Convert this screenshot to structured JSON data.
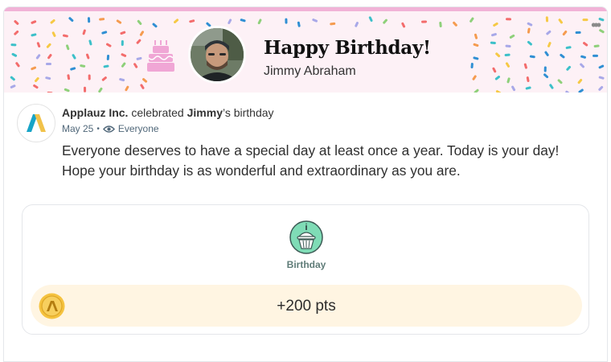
{
  "banner": {
    "title": "Happy Birthday!",
    "name": "Jimmy Abraham",
    "more_icon": "ellipsis-icon",
    "colors": {
      "background": "#fdf1f6",
      "stripe": "#f1b2d7",
      "cake": "#f0a6d5"
    }
  },
  "post": {
    "company": "Applauz Inc.",
    "action_pre": " celebrated ",
    "person": "Jimmy",
    "action_post": "’s birthday",
    "date": "May 25",
    "separator": "•",
    "visibility": "Everyone",
    "message": "Everyone deserves to have a special day at least once a year. Today is your day! Hope your birthday is as wonderful and extraordinary as you are."
  },
  "award": {
    "badge_label": "Birthday",
    "points": "+200 pts",
    "colors": {
      "badge_bg": "#7fdcb6",
      "points_bg": "#fff5e2",
      "coin": "#f5c340"
    }
  }
}
